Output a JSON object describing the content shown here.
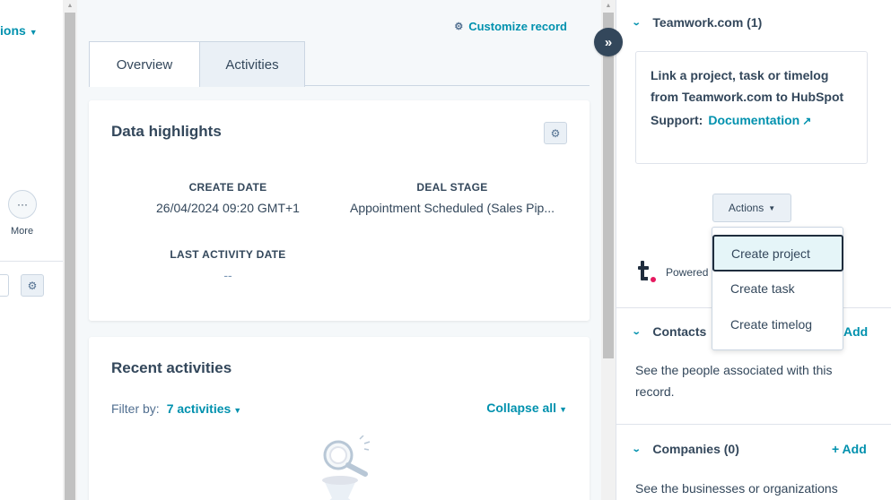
{
  "left_panel": {
    "actions_label": "ions",
    "more_label": "More",
    "more_icon": "···"
  },
  "record": {
    "customize_label": "Customize record",
    "tabs": [
      {
        "label": "Overview"
      },
      {
        "label": "Activities"
      }
    ],
    "data_highlights": {
      "title": "Data highlights",
      "fields": [
        {
          "label": "CREATE DATE",
          "value": "26/04/2024 09:20 GMT+1"
        },
        {
          "label": "DEAL STAGE",
          "value": "Appointment Scheduled (Sales Pip..."
        },
        {
          "label": "LAST ACTIVITY DATE",
          "value": "--"
        }
      ]
    },
    "recent_activities": {
      "title": "Recent activities",
      "filter_label": "Filter by:",
      "filter_value": "7 activities",
      "collapse_label": "Collapse all"
    }
  },
  "sidebar": {
    "expand_icon": "»",
    "teamwork": {
      "title": "Teamwork.com (1)",
      "description": "Link a project, task or timelog from Teamwork.com to HubSpot",
      "support_label": "Support:",
      "support_link": "Documentation",
      "actions_label": "Actions",
      "powered_label": "Powered"
    },
    "contacts": {
      "title": "Contacts",
      "add_label": "Add",
      "description": "See the people associated with this record."
    },
    "companies": {
      "title": "Companies (0)",
      "add_label": "+ Add",
      "description": "See the businesses or organizations"
    }
  },
  "actions_menu": {
    "items": [
      {
        "label": "Create project"
      },
      {
        "label": "Create task"
      },
      {
        "label": "Create timelog"
      }
    ]
  },
  "colors": {
    "link": "#0091ae",
    "text": "#33475b",
    "brand_dot": "#e6195f"
  }
}
